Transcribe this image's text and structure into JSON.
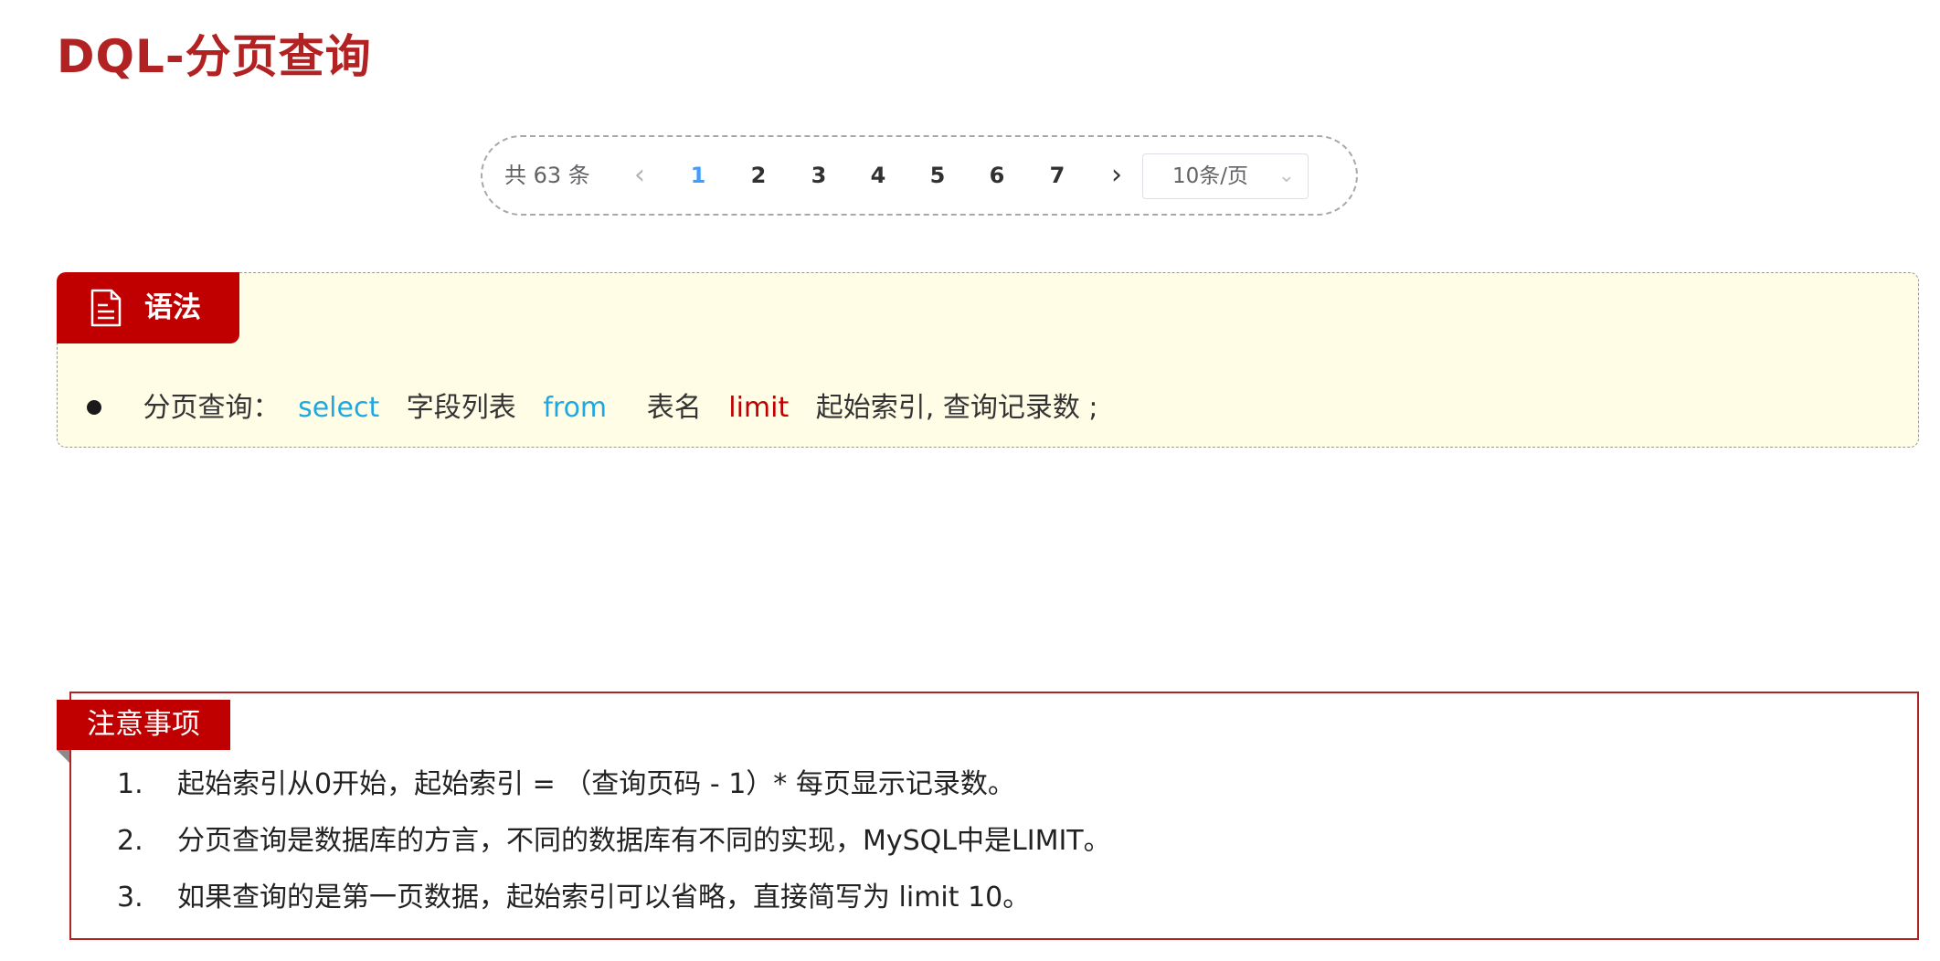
{
  "title": "DQL-分页查询",
  "pagination": {
    "total_label": "共 63 条",
    "prev_label": "‹",
    "next_label": "›",
    "pages": [
      "1",
      "2",
      "3",
      "4",
      "5",
      "6",
      "7"
    ],
    "current_page": "1",
    "page_size_label": "10条/页",
    "dropdown_chevron": "⌄",
    "active_color": "#409eff"
  },
  "syntax": {
    "tab_icon": "document-icon",
    "tab_label": "语法",
    "line": {
      "prefix": "分页查询：",
      "kw_select": "select",
      "fields": "字段列表",
      "kw_from": "from",
      "table": "表名",
      "kw_limit": "limit",
      "args": "起始索引, 查询记录数 ;"
    },
    "colors": {
      "keyword_blue": "#1fa8e0",
      "keyword_red": "#c00000",
      "panel_bg": "#fffde6"
    }
  },
  "notes": {
    "tab_label": "注意事项",
    "items": [
      {
        "num": "1.",
        "text": "起始索引从0开始，起始索引 = （查询页码 - 1）* 每页显示记录数。"
      },
      {
        "num": "2.",
        "text": "分页查询是数据库的方言，不同的数据库有不同的实现，MySQL中是LIMIT。"
      },
      {
        "num": "3.",
        "text": "如果查询的是第一页数据，起始索引可以省略，直接简写为 limit 10。"
      }
    ]
  },
  "colors": {
    "title_red": "#b22222",
    "accent_red": "#c00000"
  }
}
